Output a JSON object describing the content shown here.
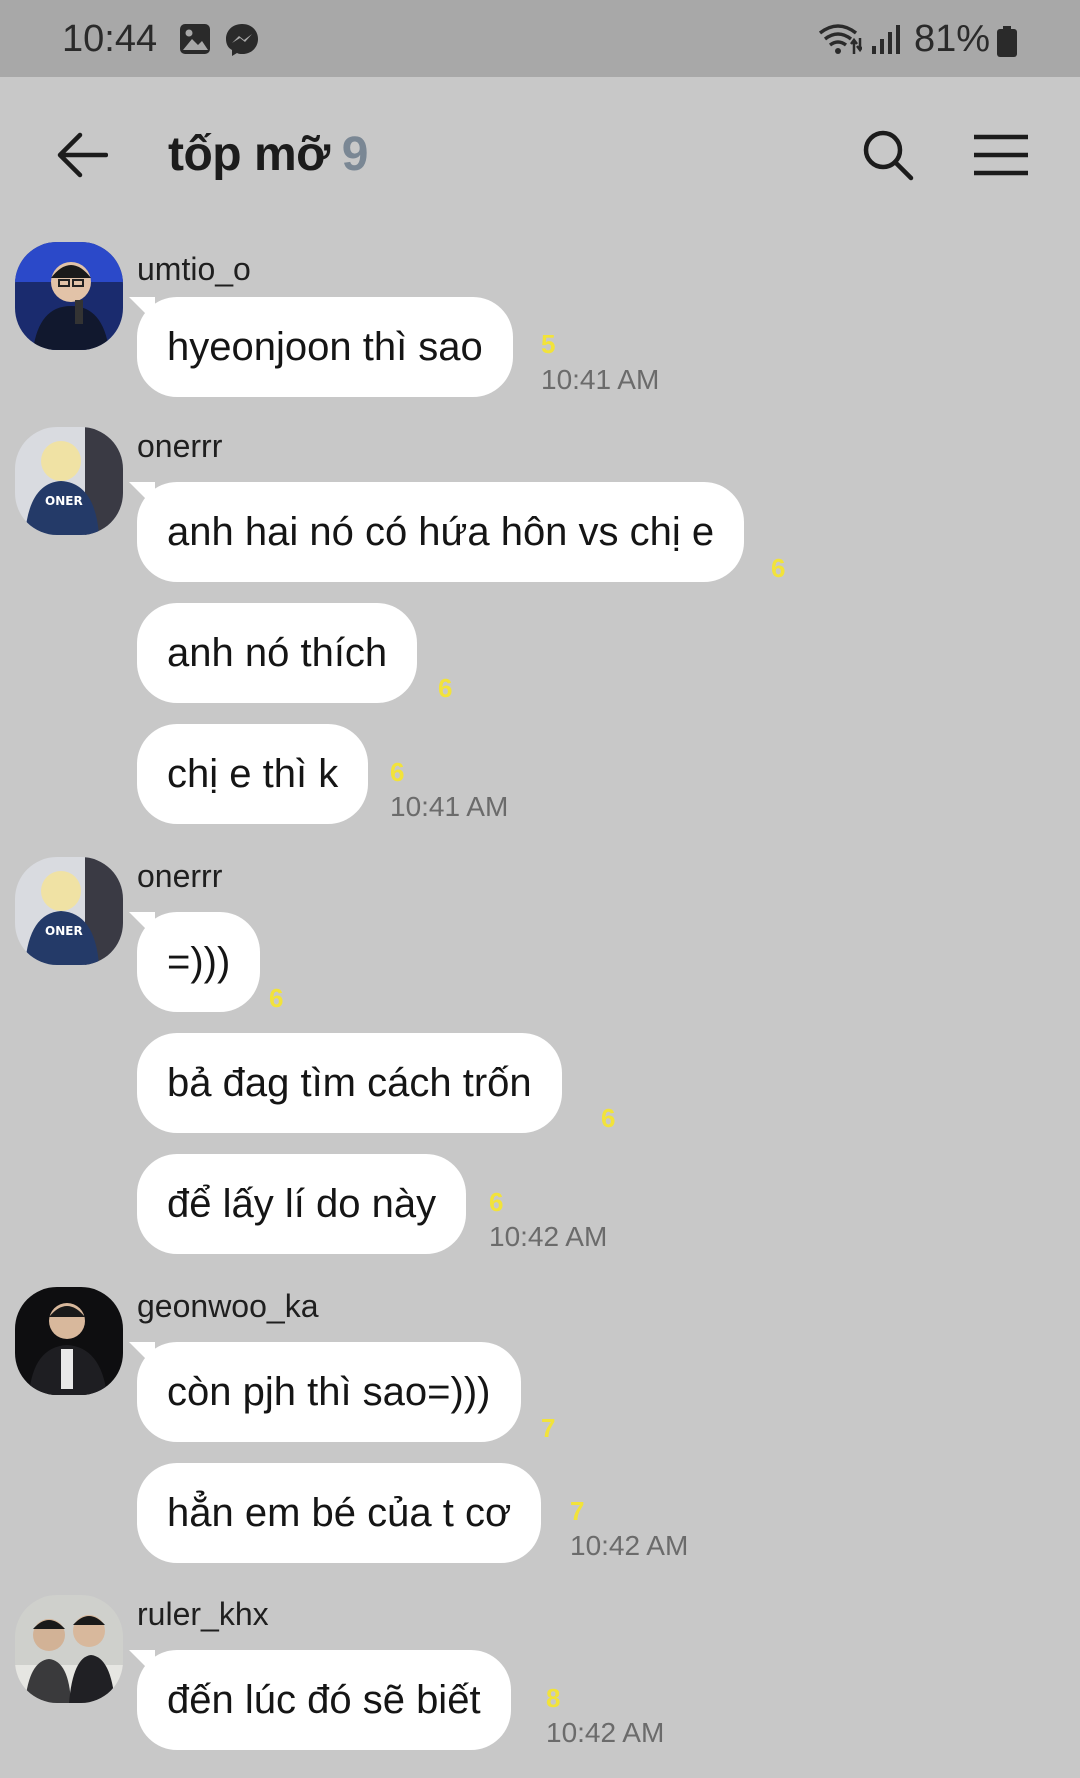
{
  "status_bar": {
    "time": "10:44",
    "battery": "81%",
    "icons": [
      "gallery-icon",
      "messenger-icon",
      "wifi-icon",
      "signal-icon",
      "battery-icon"
    ]
  },
  "header": {
    "title": "tốp mỡ",
    "member_count": "9"
  },
  "messages": [
    {
      "username": "umtio_o",
      "avatar": "avatar-umtio_o",
      "bubbles": [
        {
          "text": "hyeonjoon thì sao",
          "unread": "5",
          "time": "10:41 AM"
        }
      ]
    },
    {
      "username": "onerrr",
      "avatar": "avatar-onerrr",
      "bubbles": [
        {
          "text": "anh hai nó có hứa hôn vs chị e",
          "unread": "6",
          "time": ""
        },
        {
          "text": "anh nó thích",
          "unread": "6",
          "time": ""
        },
        {
          "text": "chị e thì k",
          "unread": "6",
          "time": "10:41 AM"
        }
      ]
    },
    {
      "username": "onerrr",
      "avatar": "avatar-onerrr",
      "bubbles": [
        {
          "text": "=)))",
          "unread": "6",
          "time": ""
        },
        {
          "text": "bả đag tìm cách trốn",
          "unread": "6",
          "time": ""
        },
        {
          "text": "để lấy lí do này",
          "unread": "6",
          "time": "10:42 AM"
        }
      ]
    },
    {
      "username": "geonwoo_ka",
      "avatar": "avatar-geonwoo_ka",
      "bubbles": [
        {
          "text": "còn pjh thì sao=)))",
          "unread": "7",
          "time": ""
        },
        {
          "text": "hẳn em bé của t cơ",
          "unread": "7",
          "time": "10:42 AM"
        }
      ]
    },
    {
      "username": "ruler_khx",
      "avatar": "avatar-ruler_khx",
      "bubbles": [
        {
          "text": "đến lúc đó sẽ biết",
          "unread": "8",
          "time": "10:42 AM"
        }
      ]
    }
  ],
  "colors": {
    "background": "#c8c8c8",
    "status_bar": "#a8a8a8",
    "bubble": "#ffffff",
    "unread": "#f2e33a",
    "count": "#7a8794"
  }
}
